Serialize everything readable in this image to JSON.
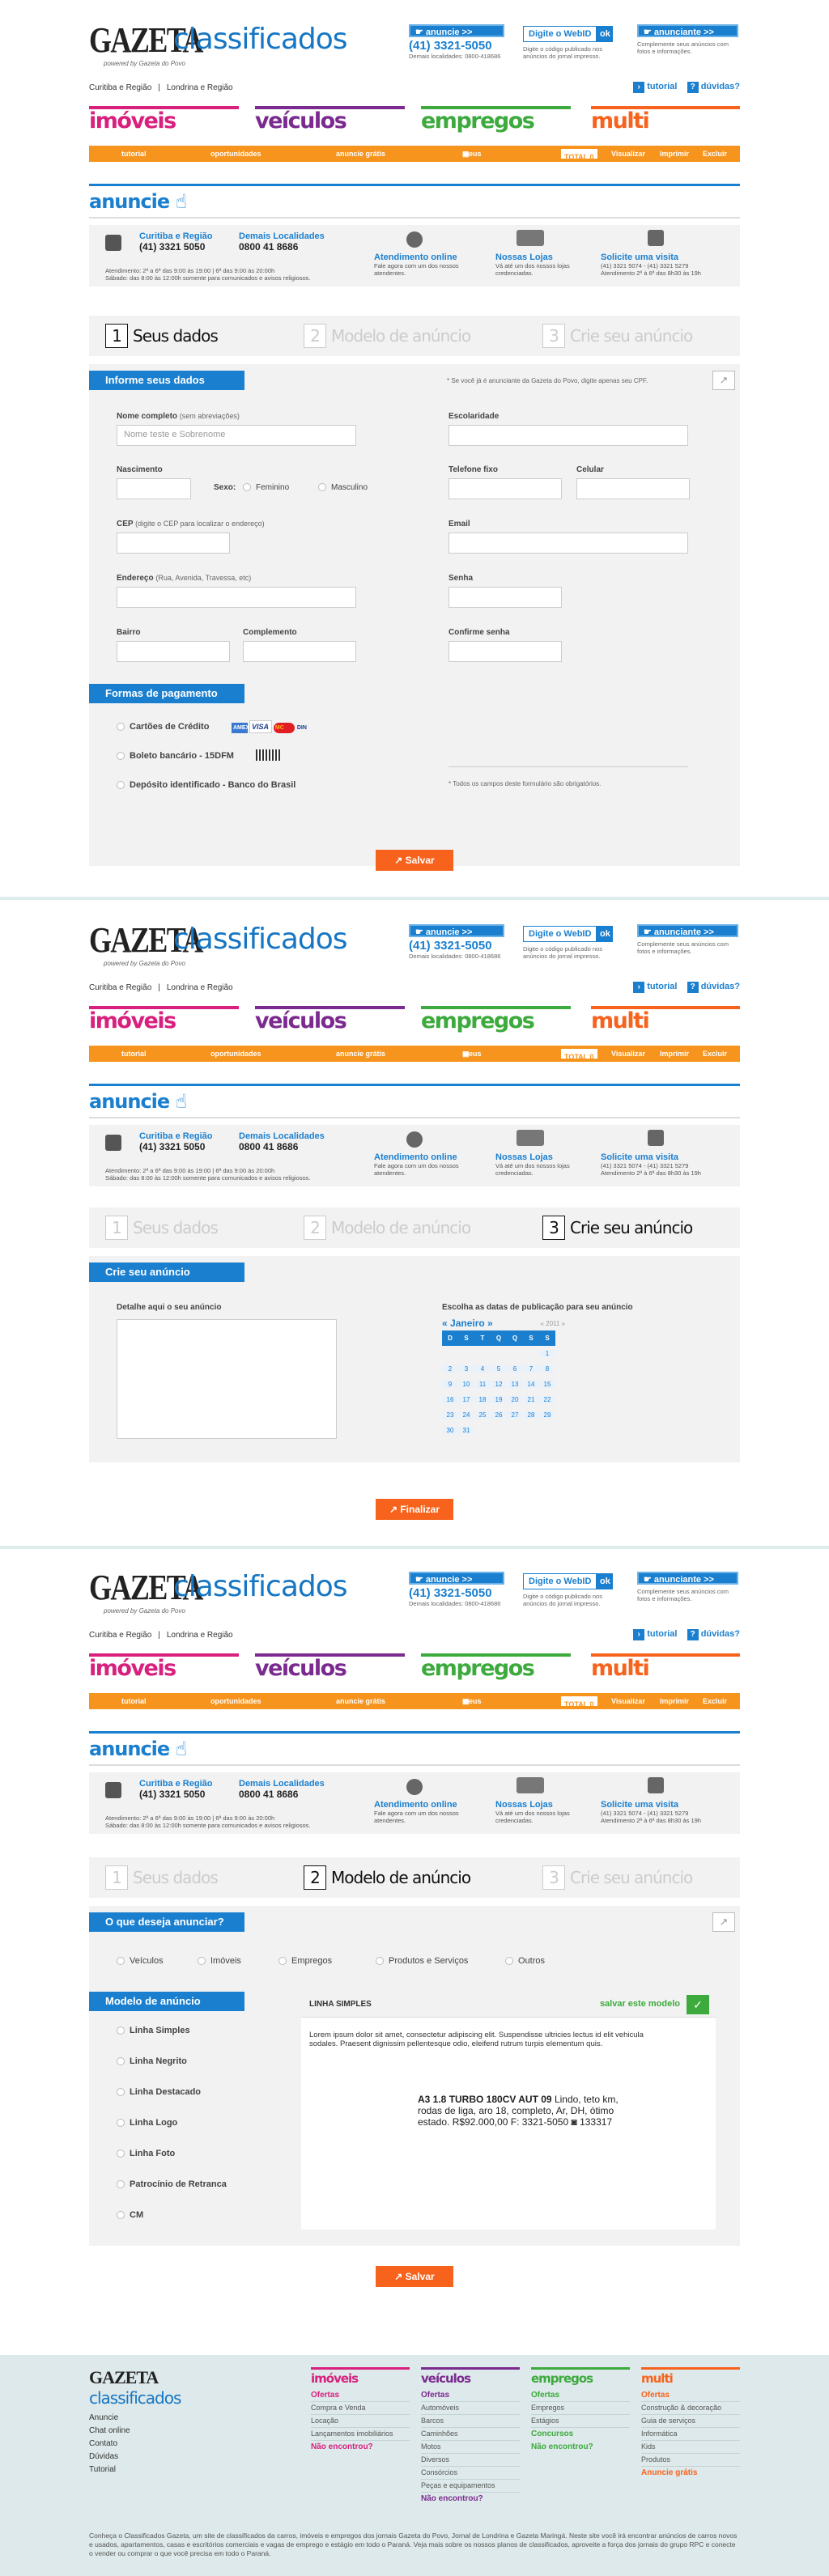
{
  "header": {
    "logo_gazeta": "GAZETA",
    "logo_classificados": "classificados",
    "logo_powered": "powered by Gazeta do Povo",
    "anuncie_btn": "anuncie >>",
    "phone": "(41) 3321-5050",
    "phone_sub": "Demais localidades: 0800-418686",
    "webid_label": "Digite o WebID",
    "ok_label": "ok",
    "webid_sub": "Digite o código publicado nos anúncios do jornal impresso.",
    "anunciante_btn": "anunciante >>",
    "anunciante_sub": "Complemente seus anúncios com fotos e informações.",
    "city1": "Curitiba e Região",
    "city2": "Londrina e Região",
    "tutorial": "tutorial",
    "duvidas": "dúvidas?",
    "categories": [
      {
        "label": "imóveis",
        "color": "#d8207e"
      },
      {
        "label": "veículos",
        "color": "#7b2a8f"
      },
      {
        "label": "empregos",
        "color": "#3caa3c"
      },
      {
        "label": "multi",
        "color": "#f7631d"
      }
    ],
    "subnav": [
      "tutorial",
      "oportunidades",
      "anuncie grátis"
    ],
    "meus_anuncios": "meus anúncios",
    "total": "TOTAL 0",
    "visualizar": "Visualizar",
    "imprimir": "Imprimir",
    "excluir": "Excluir"
  },
  "anuncie_title": "anuncie",
  "contact": {
    "c1_title": "Curitiba e Região",
    "c1_phone": "(41) 3321 5050",
    "c2_title": "Demais Localidades",
    "c2_phone": "0800 41 8686",
    "hours": "Atendimento: 2ª a 6ª das 9:00 às 19:00 | 6ª das 9:00 às 20:00h",
    "hours2": "Sábado: das 8:00 às 12:00h somente para comunicados e avisos religiosos.",
    "online_title": "Atendimento online",
    "online_text": "Fale agora com um dos nossos atendentes.",
    "lojas_title": "Nossas Lojas",
    "lojas_text": "Vá até um dos nossos lojas credenciadas.",
    "visita_title": "Solicite uma visita",
    "visita_text": "(41) 3321 5074 - (41) 3321 5279",
    "visita_text2": "Atendimento 2ª à 6ª das 8h30 às 19h"
  },
  "steps": [
    {
      "num": "1",
      "label": "Seus dados"
    },
    {
      "num": "2",
      "label": "Modelo de anúncio"
    },
    {
      "num": "3",
      "label": "Crie seu anúncio"
    }
  ],
  "form1": {
    "tab": "Informe seus dados",
    "hint": "* Se você já é anunciante da Gazeta do Povo, digite apenas seu CPF.",
    "nome_label": "Nome completo",
    "nome_hint": "(sem abreviações)",
    "nome_placeholder": "Nome teste e Sobrenome",
    "escolaridade": "Escolaridade",
    "nascimento": "Nascimento",
    "sexo": "Sexo:",
    "feminino": "Feminino",
    "masculino": "Masculino",
    "telefone": "Telefone fixo",
    "celular": "Celular",
    "cep": "CEP",
    "cep_hint": "(digite o CEP para localizar o endereço)",
    "email": "Email",
    "endereco": "Endereço",
    "endereco_hint": "(Rua, Avenida, Travessa, etc)",
    "senha": "Senha",
    "bairro": "Bairro",
    "complemento": "Complemento",
    "confirme": "Confirme senha",
    "pag_tab": "Formas de pagamento",
    "cartoes": "Cartões de Crédito",
    "boleto": "Boleto bancário - 15DFM",
    "deposito": "Depósito identificado - Banco do Brasil",
    "obrig": "* Todos os campos deste formulário são obrigatórios.",
    "salvar": "Salvar",
    "card_brands": [
      "AMEX",
      "VISA",
      "MC",
      "DIN"
    ]
  },
  "form3": {
    "tab": "Crie seu anúncio",
    "detalhe": "Detalhe aqui o seu anúncio",
    "datas": "Escolha as datas de publicação para seu anúncio",
    "month": "Janeiro",
    "year": "2011",
    "weekdays": [
      "D",
      "S",
      "T",
      "Q",
      "Q",
      "S",
      "S"
    ],
    "days": [
      [
        "",
        "",
        "",
        "",
        "",
        "",
        "1"
      ],
      [
        "2",
        "3",
        "4",
        "5",
        "6",
        "7",
        "8"
      ],
      [
        "9",
        "10",
        "11",
        "12",
        "13",
        "14",
        "15"
      ],
      [
        "16",
        "17",
        "18",
        "19",
        "20",
        "21",
        "22"
      ],
      [
        "23",
        "24",
        "25",
        "26",
        "27",
        "28",
        "29"
      ],
      [
        "30",
        "31",
        "",
        "",
        "",
        "",
        ""
      ]
    ],
    "finalizar": "Finalizar"
  },
  "form2": {
    "tab": "O que deseja anunciar?",
    "options": [
      "Veículos",
      "Imóveis",
      "Empregos",
      "Produtos e Serviços",
      "Outros"
    ],
    "modelo_tab": "Modelo de anúncio",
    "modelos": [
      "Linha Simples",
      "Linha Negrito",
      "Linha Destacado",
      "Linha Logo",
      "Linha Foto",
      "Patrocínio de Retranca",
      "CM"
    ],
    "preview_title": "LINHA SIMPLES",
    "salvar_modelo": "salvar este modelo",
    "lorem": "Lorem ipsum dolor sit amet, consectetur adipiscing elit. Suspendisse ultricies lectus id elit vehicula sodales. Praesent dignissim pellentesque odio, eleifend rutrum turpis elementum quis.",
    "ad_bold": "A3 1.8 TURBO 180CV AUT 09",
    "ad_text1": " Lindo, teto km,",
    "ad_text2": "rodas de liga, aro 18, completo, Ar, DH, ótimo",
    "ad_text3": "estado. R$92.000,00 F: 3321-5050",
    "ad_code": "133317",
    "salvar": "Salvar"
  },
  "footer": {
    "links": [
      "Anuncie",
      "Chat online",
      "Contato",
      "Dúvidas",
      "Tutorial"
    ],
    "imoveis": {
      "title": "imóveis",
      "items": [
        "Ofertas",
        "Compra e Venda",
        "Locação",
        "Lançamentos imobiliários"
      ],
      "extra": "Não encontrou?"
    },
    "veiculos": {
      "title": "veículos",
      "items": [
        "Ofertas",
        "Automóveis",
        "Barcos",
        "Caminhões",
        "Motos",
        "Diversos",
        "Consórcios",
        "Peças e equipamentos"
      ],
      "extra": "Não encontrou?"
    },
    "empregos": {
      "title": "empregos",
      "items": [
        "Ofertas",
        "Empregos",
        "Estágios"
      ],
      "extra1": "Concursos",
      "extra": "Não encontrou?"
    },
    "multi": {
      "title": "multi",
      "items": [
        "Ofertas",
        "Construção & decoração",
        "Guia de serviços",
        "Informática",
        "Kids",
        "Produtos"
      ],
      "extra": "Anuncie grátis"
    },
    "legal": "Conheça o Classificados Gazeta, um site de classificados da carros, imóveis e empregos dos jornais Gazeta do Povo, Jornal de Londrina e Gazeta Maringá. Neste site você irá encontrar anúncios de carros novos e usados, apartamentos, casas e escritórios comerciais e vagas de emprego e estágio em todo o Paraná. Veja mais sobre os nossos planos de classificados, aproveite a força dos jornais do grupo RPC e conecte o vender ou comprar o que você precisa em todo o Paraná."
  }
}
